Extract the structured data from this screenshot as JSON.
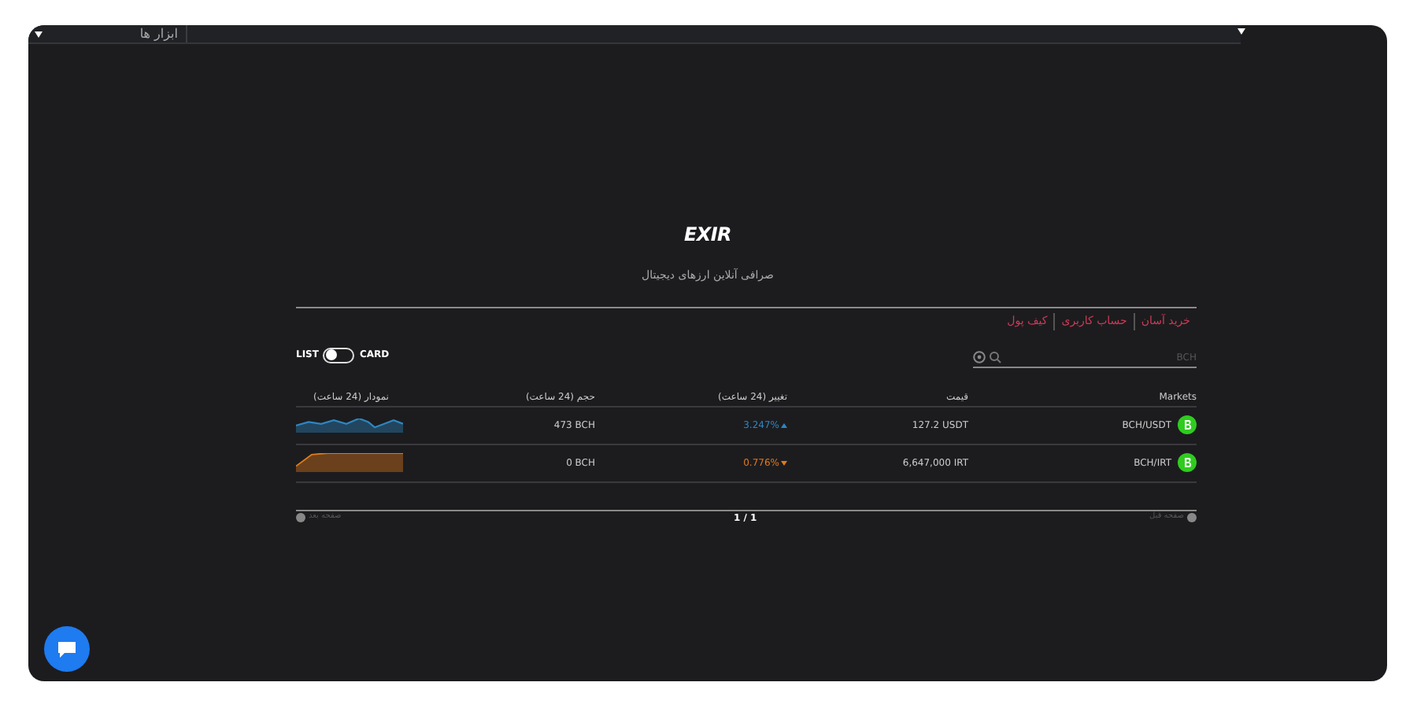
{
  "top_bar": {
    "menu_label": "ابزار ها"
  },
  "logo": {
    "text": "EXIR",
    "tagline": "صرافی آنلاین ارزهای دیجیتال"
  },
  "links": [
    "خرید آسان",
    "حساب کاربری",
    "کیف پول"
  ],
  "view_toggle": {
    "labels": [
      "CARD",
      "LIST"
    ],
    "card_view": false
  },
  "search": {
    "placeholder": "BCH"
  },
  "table": {
    "columns": [
      "Markets",
      "قیمت",
      "تغییر (24 ساعت)",
      "حجم (24 ساعت)",
      "نمودار (24 ساعت)"
    ],
    "rows": [
      {
        "market": "BCH/USDT",
        "price": "127.2",
        "price_unit": "USDT",
        "change": "3.247%",
        "rising": true,
        "volume": "473",
        "volume_unit": "BCH",
        "color": "#2e86c1"
      },
      {
        "market": "BCH/IRT",
        "price": "6,647,000",
        "price_unit": "IRT",
        "change": "0.776%",
        "rising": false,
        "volume": "0",
        "volume_unit": "BCH",
        "color": "#e07b1a"
      }
    ]
  },
  "pagination": {
    "previous": "صفحه قبل",
    "page": "1 / 1",
    "next": "صفحه بعد"
  }
}
